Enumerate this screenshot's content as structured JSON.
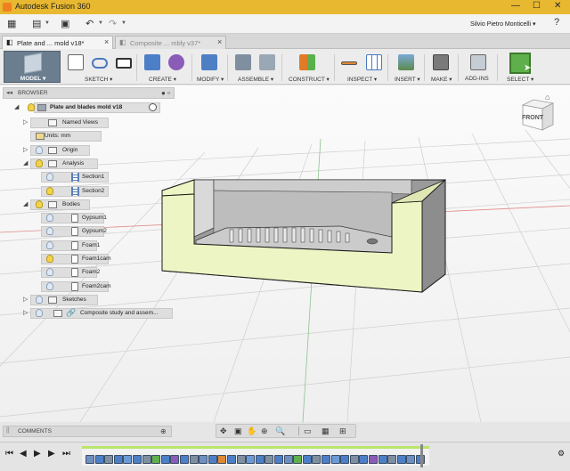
{
  "app": {
    "title": "Autodesk Fusion 360",
    "user": "Silvio Pietro Monticelli"
  },
  "tabs": [
    {
      "label": "Plate and ... mold v18*",
      "active": true
    },
    {
      "label": "Composite ... mbly v37*",
      "active": false
    }
  ],
  "toolbar": {
    "workspace": "MODEL",
    "groups": [
      "SKETCH",
      "CREATE",
      "MODIFY",
      "ASSEMBLE",
      "CONSTRUCT",
      "INSPECT",
      "INSERT",
      "MAKE",
      "ADD-INS",
      "SELECT"
    ]
  },
  "browser": {
    "title": "BROWSER",
    "root": "Plate and blades mold v18",
    "items": [
      {
        "label": "Named Views",
        "icon": "folder-icon",
        "level": 1,
        "bulb": "none"
      },
      {
        "label": "Units: mm",
        "icon": "units-icon",
        "level": 1,
        "bulb": "none"
      },
      {
        "label": "Origin",
        "icon": "folder-icon",
        "level": 1,
        "bulb": "off"
      },
      {
        "label": "Analysis",
        "icon": "folder-icon",
        "level": 1,
        "bulb": "on"
      },
      {
        "label": "Section1",
        "icon": "section-icon",
        "level": 2,
        "bulb": "off"
      },
      {
        "label": "Section2",
        "icon": "section-icon",
        "level": 2,
        "bulb": "on"
      },
      {
        "label": "Bodies",
        "icon": "folder-icon",
        "level": 1,
        "bulb": "on"
      },
      {
        "label": "Gypsum1",
        "icon": "body-icon",
        "level": 2,
        "bulb": "off"
      },
      {
        "label": "Gypsum2",
        "icon": "body-icon",
        "level": 2,
        "bulb": "off"
      },
      {
        "label": "Foam1",
        "icon": "body-icon",
        "level": 2,
        "bulb": "off"
      },
      {
        "label": "Foam1cam",
        "icon": "body-icon",
        "level": 2,
        "bulb": "on"
      },
      {
        "label": "Foam2",
        "icon": "body-icon",
        "level": 2,
        "bulb": "off"
      },
      {
        "label": "Foam2cam",
        "icon": "body-icon",
        "level": 2,
        "bulb": "off"
      },
      {
        "label": "Sketches",
        "icon": "folder-icon",
        "level": 1,
        "bulb": "off"
      },
      {
        "label": "Composite study and assem...",
        "icon": "link-icon",
        "level": 1,
        "bulb": "off"
      }
    ]
  },
  "viewcube": {
    "face": "FRONT"
  },
  "comments": {
    "title": "COMMENTS"
  },
  "colors": {
    "titlebar": "#e8b830",
    "accent_green": "#b8e56b",
    "model_face": "#eef5c4",
    "model_edge": "#1c1c1c",
    "model_shade": "#8a8a8a"
  }
}
